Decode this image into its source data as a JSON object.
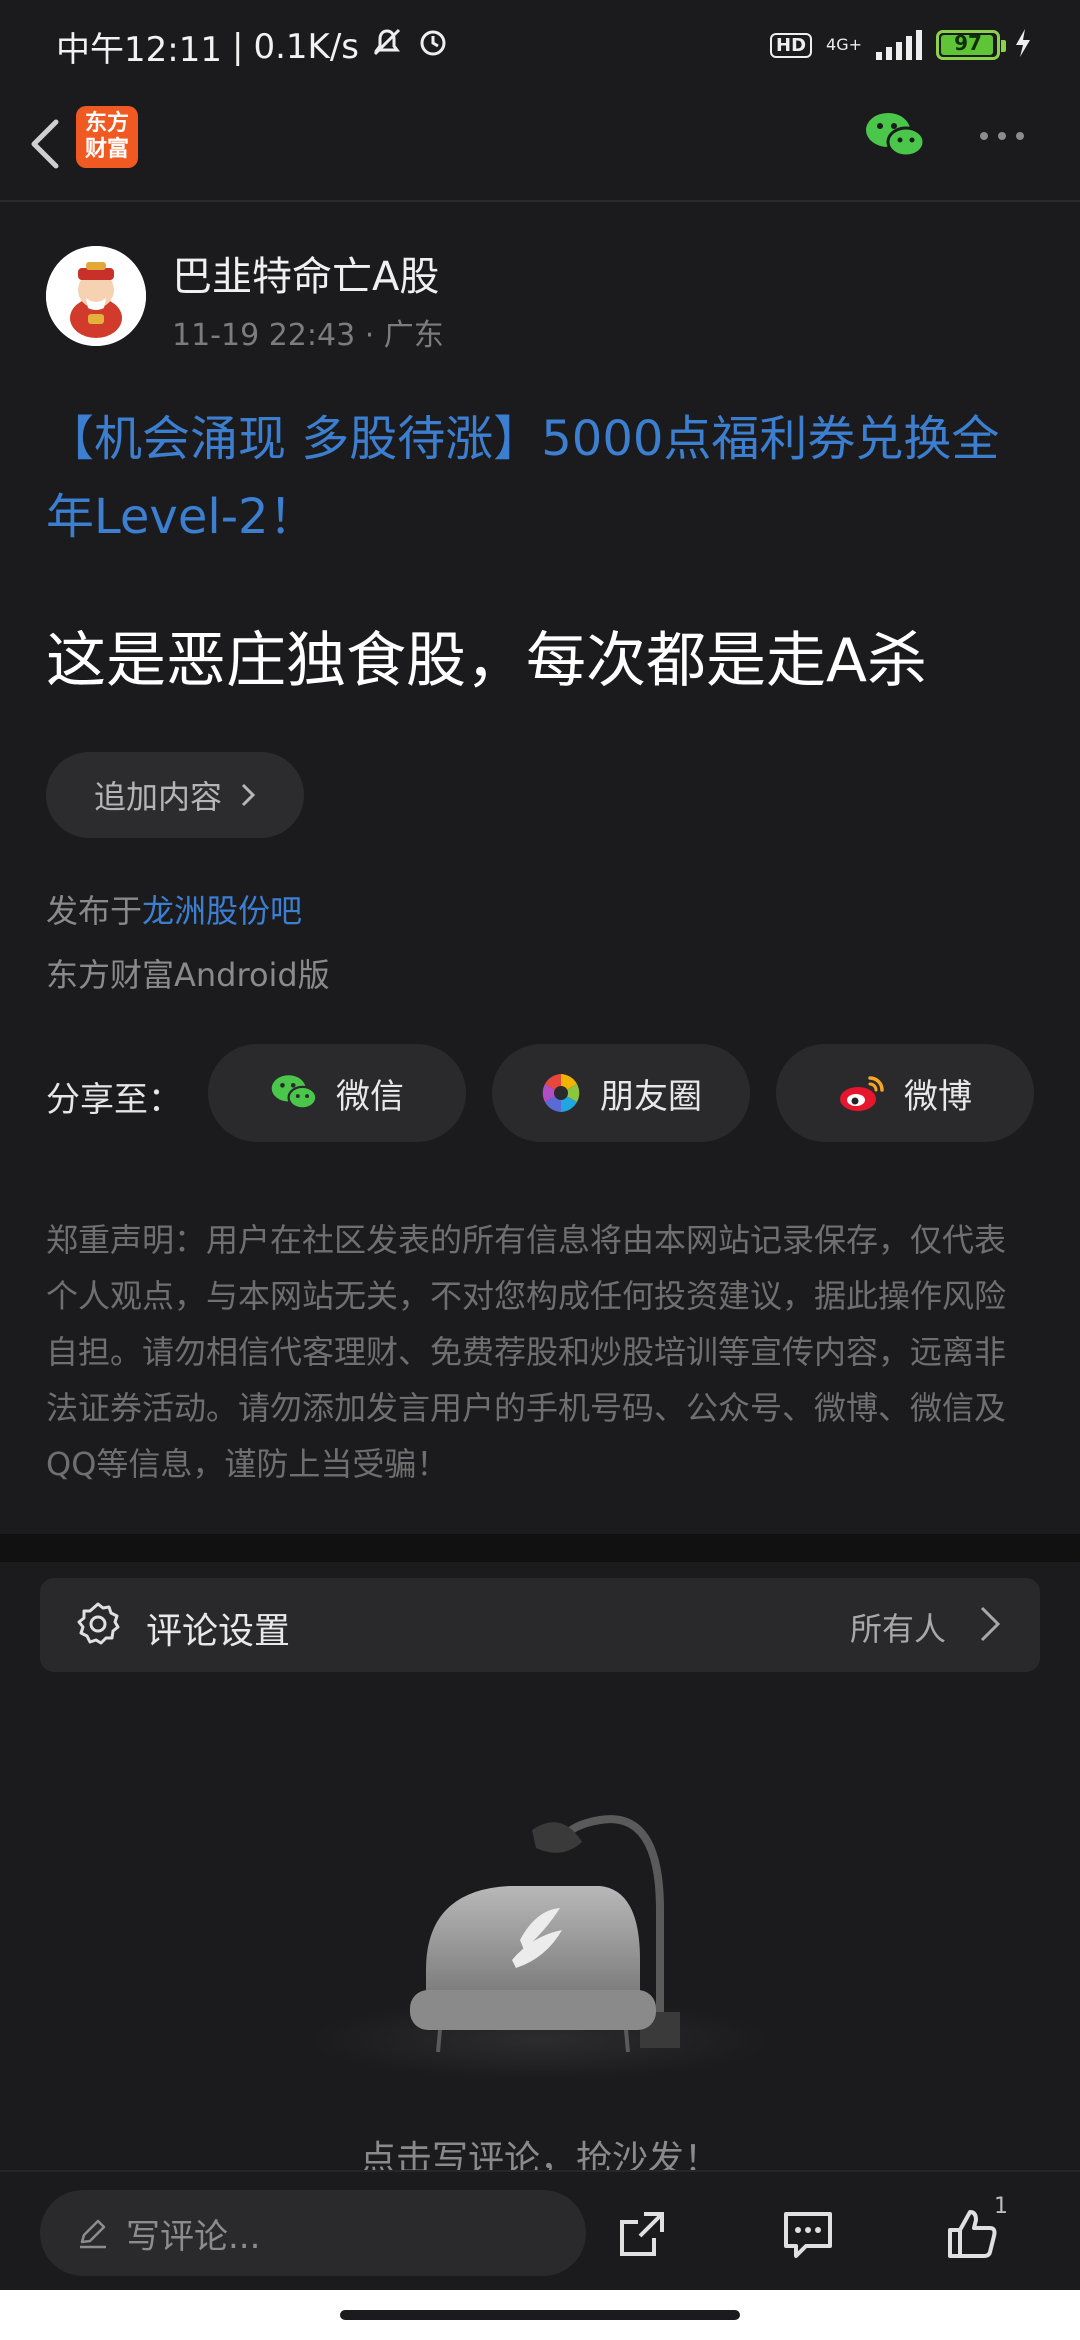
{
  "status_bar": {
    "time": "中午12:11",
    "net_speed": "0.1K/s",
    "hd": "HD",
    "network": "4G+",
    "battery": "97"
  },
  "nav": {
    "logo_text": "东方\n财富"
  },
  "post": {
    "username": "巴韭特命亡A股",
    "time": "11-19 22:43",
    "location": "广东",
    "promo": "【机会涌现 多股待涨】5000点福利券兑换全年Level-2！",
    "content": "这是恶庄独食股，每次都是走A杀",
    "append_label": "追加内容",
    "posted_prefix": "发布于",
    "posted_forum": "龙洲股份吧",
    "client": "东方财富Android版"
  },
  "share": {
    "label": "分享至：",
    "wechat": "微信",
    "moments": "朋友圈",
    "weibo": "微博"
  },
  "disclaimer": "郑重声明：用户在社区发表的所有信息将由本网站记录保存，仅代表个人观点，与本网站无关，不对您构成任何投资建议，据此操作风险自担。请勿相信代客理财、免费荐股和炒股培训等宣传内容，远离非法证券活动。请勿添加发言用户的手机号码、公众号、微博、微信及QQ等信息，谨防上当受骗！",
  "comment_settings": {
    "label": "评论设置",
    "value": "所有人"
  },
  "empty_state": {
    "text": "点击写评论，抢沙发！"
  },
  "bottom_bar": {
    "placeholder": "写评论...",
    "like_count": "1"
  },
  "colors": {
    "background": "#1b1b1d",
    "link_blue": "#3c7fd1",
    "brand_orange": "#f05a22",
    "wechat_green": "#4ac64a"
  }
}
